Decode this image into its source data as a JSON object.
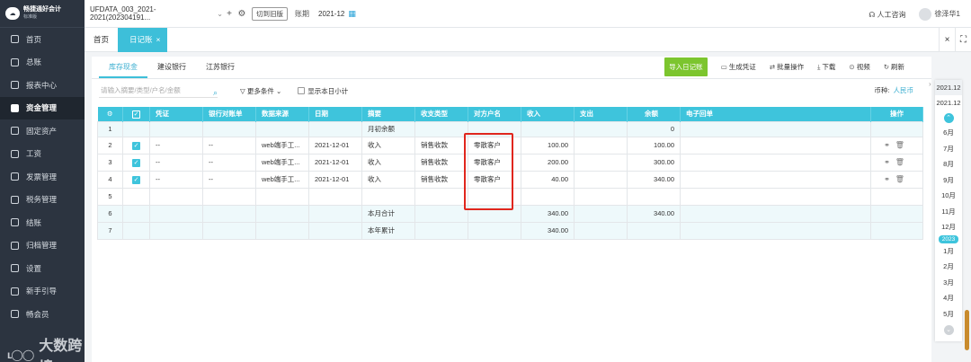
{
  "app": {
    "title": "畅捷通好会计",
    "edition": "标准版"
  },
  "sidebar": {
    "items": [
      {
        "label": "首页"
      },
      {
        "label": "总账"
      },
      {
        "label": "报表中心"
      },
      {
        "label": "资金管理"
      },
      {
        "label": "固定资产"
      },
      {
        "label": "工资"
      },
      {
        "label": "发票管理"
      },
      {
        "label": "税务管理"
      },
      {
        "label": "结账"
      },
      {
        "label": "归档管理"
      },
      {
        "label": "设置"
      },
      {
        "label": "新手引导"
      },
      {
        "label": "畅会员"
      }
    ],
    "active_index": 3
  },
  "watermark": {
    "mark": "ŀ̀ↄ̀0",
    "text": "大数跨境"
  },
  "topbar": {
    "account": "UFDATA_003_2021-2021(202304191...",
    "switch_label": "切到旧版",
    "period_label": "账期",
    "period_value": "2021-12",
    "service": "人工咨询",
    "user": "徐泽华1"
  },
  "page_tabs": {
    "home": "首页",
    "journal": "日记账",
    "close": "×"
  },
  "subtabs": [
    {
      "label": "库存现金"
    },
    {
      "label": "建设银行"
    },
    {
      "label": "江苏银行"
    }
  ],
  "toolbar": {
    "import": "导入日记账",
    "generate": "生成凭证",
    "batch": "批量操作",
    "download": "下载",
    "video": "视频",
    "refresh": "刷新"
  },
  "filter": {
    "search_placeholder": "请输入摘要/类型/户名/金额",
    "more": "更多条件",
    "daily_subtotal": "显示本日小计",
    "currency_label": "币种:",
    "currency_value": "人民币"
  },
  "table": {
    "headers": [
      "",
      "",
      "凭证",
      "银行对账单",
      "数据来源",
      "日期",
      "摘要",
      "收支类型",
      "对方户名",
      "收入",
      "支出",
      "余额",
      "电子回单",
      "操作"
    ],
    "rows": [
      {
        "no": "1",
        "summary": "月初余额",
        "balance": "0",
        "type": "open"
      },
      {
        "no": "2",
        "voucher": "--",
        "bank": "--",
        "source": "web端手工...",
        "date": "2021-12-01",
        "summary": "收入",
        "category": "销售收款",
        "party": "零散客户",
        "income": "100.00",
        "balance": "100.00",
        "type": "entry"
      },
      {
        "no": "3",
        "voucher": "--",
        "bank": "--",
        "source": "web端手工...",
        "date": "2021-12-01",
        "summary": "收入",
        "category": "销售收款",
        "party": "零散客户",
        "income": "200.00",
        "balance": "300.00",
        "type": "entry"
      },
      {
        "no": "4",
        "voucher": "--",
        "bank": "--",
        "source": "web端手工...",
        "date": "2021-12-01",
        "summary": "收入",
        "category": "销售收款",
        "party": "零散客户",
        "income": "40.00",
        "balance": "340.00",
        "type": "entry"
      },
      {
        "no": "5",
        "type": "blank"
      },
      {
        "no": "6",
        "summary": "本月合计",
        "income": "340.00",
        "balance": "340.00",
        "type": "sum"
      },
      {
        "no": "7",
        "summary": "本年累计",
        "income": "340.00",
        "type": "sum"
      }
    ]
  },
  "datestrip": {
    "years": [
      "2021.12",
      "2021.12"
    ],
    "months_top": [
      "6月",
      "7月",
      "8月",
      "9月",
      "10月",
      "11月",
      "12月"
    ],
    "year_badge": "2023",
    "months_bottom": [
      "1月",
      "2月",
      "3月",
      "4月",
      "5月"
    ]
  },
  "colors": {
    "accent": "#3ec4dc",
    "sidebar": "#2c3440",
    "green": "#7cc52e",
    "highlight": "#e0261d"
  }
}
